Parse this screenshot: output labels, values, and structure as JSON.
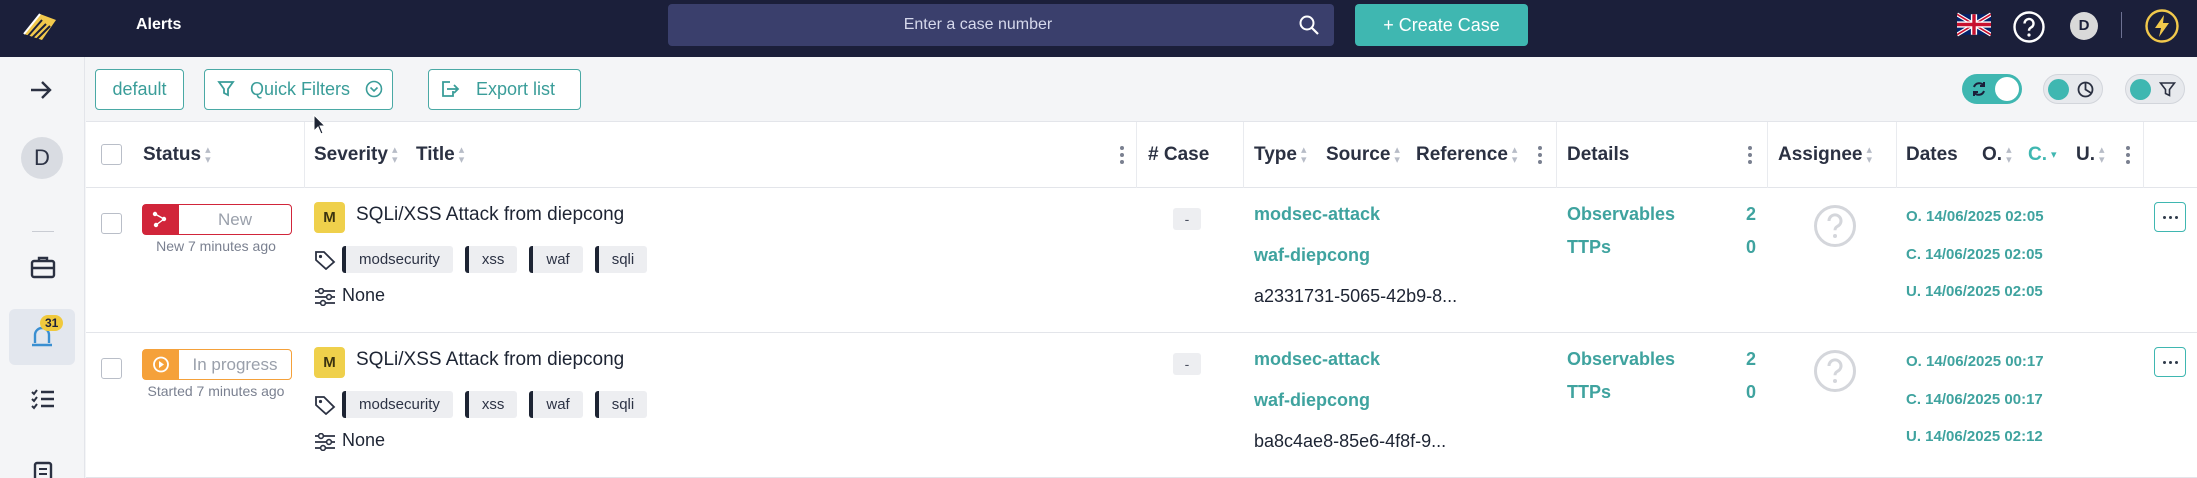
{
  "app": {
    "title": "Alerts"
  },
  "search": {
    "placeholder": "Enter a case number"
  },
  "create_case": {
    "label": "+ Create Case"
  },
  "user": {
    "initial": "D"
  },
  "sidebar": {
    "alerts_badge": "31",
    "avatar_initial": "D"
  },
  "toolbar": {
    "default_label": "default",
    "quick_filters_label": "Quick Filters",
    "export_label": "Export list"
  },
  "columns": {
    "status": "Status",
    "severity": "Severity",
    "title": "Title",
    "case": "# Case",
    "type": "Type",
    "source": "Source",
    "reference": "Reference",
    "details": "Details",
    "assignee": "Assignee",
    "dates": "Dates",
    "date_o": "O.",
    "date_c": "C.",
    "date_u": "U."
  },
  "rows": [
    {
      "status": "New",
      "status_sub": "New 7 minutes ago",
      "severity": "M",
      "title": "SQLi/XSS Attack from diepcong",
      "tags": [
        "modsecurity",
        "xss",
        "waf",
        "sqli"
      ],
      "custom_fields": "None",
      "case": "-",
      "type": "modsec-attack",
      "source": "waf-diepcong",
      "reference": "a2331731-5065-42b9-8...",
      "observables_label": "Observables",
      "observables_count": "2",
      "ttps_label": "TTPs",
      "ttps_count": "0",
      "date_o": "O. 14/06/2025 02:05",
      "date_c": "C. 14/06/2025 02:05",
      "date_u": "U. 14/06/2025 02:05"
    },
    {
      "status": "In progress",
      "status_sub": "Started 7 minutes ago",
      "severity": "M",
      "title": "SQLi/XSS Attack from diepcong",
      "tags": [
        "modsecurity",
        "xss",
        "waf",
        "sqli"
      ],
      "custom_fields": "None",
      "case": "-",
      "type": "modsec-attack",
      "source": "waf-diepcong",
      "reference": "ba8c4ae8-85e6-4f8f-9...",
      "observables_label": "Observables",
      "observables_count": "2",
      "ttps_label": "TTPs",
      "ttps_count": "0",
      "date_o": "O. 14/06/2025 00:17",
      "date_c": "C. 14/06/2025 00:17",
      "date_u": "U. 14/06/2025 02:12"
    }
  ],
  "colors": {
    "topbar": "#1b1f3a",
    "accent": "#3fb7b1",
    "new": "#d1253a",
    "in_progress": "#f5a13a",
    "severity_medium": "#efd04b"
  }
}
